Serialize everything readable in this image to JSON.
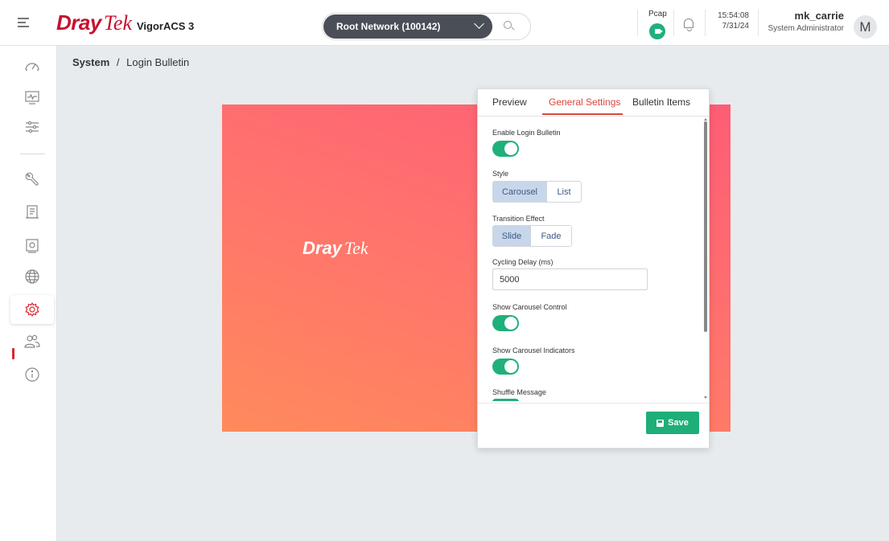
{
  "header": {
    "brand_dray": "Dray",
    "brand_tek": "Tek",
    "product": "VigorACS 3",
    "network_selector": "Root Network (100142)",
    "pcap_label": "Pcap",
    "time": "15:54:08",
    "date": "7/31/24",
    "user_name": "mk_carrie",
    "user_role": "System Administrator",
    "avatar_initial": "M"
  },
  "sidebar": {
    "items": [
      {
        "icon": "dashboard-icon"
      },
      {
        "icon": "monitoring-icon"
      },
      {
        "icon": "configuration-icon"
      },
      {
        "icon": "maintenance-icon"
      },
      {
        "icon": "provisioning-icon"
      },
      {
        "icon": "device-icon"
      },
      {
        "icon": "network-icon"
      },
      {
        "icon": "system-settings-icon",
        "active": true
      },
      {
        "icon": "users-icon"
      },
      {
        "icon": "info-icon"
      }
    ]
  },
  "breadcrumb": {
    "section": "System",
    "separator": "/",
    "page": "Login Bulletin"
  },
  "preview": {
    "brand_dray": "Dray",
    "brand_tek": "Tek"
  },
  "panel": {
    "tabs": [
      "Preview",
      "General Settings",
      "Bulletin Items"
    ],
    "active_tab": "General Settings",
    "fields": {
      "enable_login_bulletin": {
        "label": "Enable Login Bulletin",
        "value": true
      },
      "style": {
        "label": "Style",
        "options": [
          "Carousel",
          "List"
        ],
        "selected": "Carousel"
      },
      "transition_effect": {
        "label": "Transition Effect",
        "options": [
          "Slide",
          "Fade"
        ],
        "selected": "Slide"
      },
      "cycling_delay": {
        "label": "Cycling Delay (ms)",
        "value": "5000"
      },
      "show_carousel_control": {
        "label": "Show Carousel Control",
        "value": true
      },
      "show_carousel_indicators": {
        "label": "Show Carousel Indicators",
        "value": true
      },
      "shuffle_message": {
        "label": "Shuffle Message",
        "value": true
      }
    },
    "save_label": "Save"
  },
  "colors": {
    "brand_red": "#c8102e",
    "accent_green": "#20b07a",
    "tab_active": "#d9463e",
    "segment_selected": "#c8d6ea"
  }
}
